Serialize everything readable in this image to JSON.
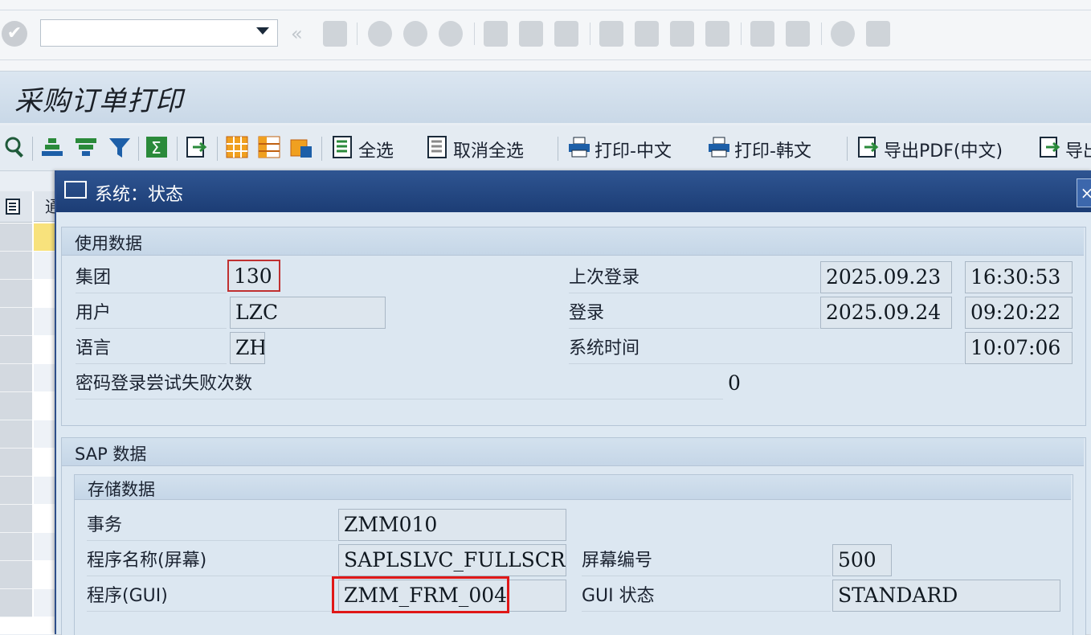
{
  "screen_title": "采购订单打印",
  "app_toolbar": {
    "select_all": "全选",
    "deselect_all": "取消全选",
    "print_cn": "打印-中文",
    "print_kr": "打印-韩文",
    "export_pdf_cn": "导出PDF(中文)",
    "export_cut": "导出"
  },
  "grid_header_partial": "通",
  "dialog": {
    "title": "系统：状态",
    "usage": {
      "header": "使用数据",
      "client_label": "集团",
      "client": "130",
      "user_label": "用户",
      "user": "LZC",
      "language_label": "语言",
      "language": "ZH",
      "failed_logons_label": "密码登录尝试失败次数",
      "failed_logons": "0",
      "last_logon_label": "上次登录",
      "last_logon_date": "2025.09.23",
      "last_logon_time": "16:30:53",
      "logon_label": "登录",
      "logon_date": "2025.09.24",
      "logon_time": "09:20:22",
      "system_time_label": "系统时间",
      "system_time": "10:07:06"
    },
    "sap": {
      "header": "SAP 数据",
      "repo_header": "存储数据",
      "transaction_label": "事务",
      "transaction": "ZMM010",
      "program_screen_label": "程序名称(屏幕)",
      "program_screen": "SAPLSLVC_FULLSCRE…",
      "screen_number_label": "屏幕编号",
      "screen_number": "500",
      "program_gui_label": "程序(GUI)",
      "program_gui": "ZMM_FRM_004",
      "gui_status_label": "GUI 状态",
      "gui_status": "STANDARD"
    }
  },
  "colors": {
    "dialog_header": "#1c3d75",
    "highlight_red": "#e01818"
  }
}
